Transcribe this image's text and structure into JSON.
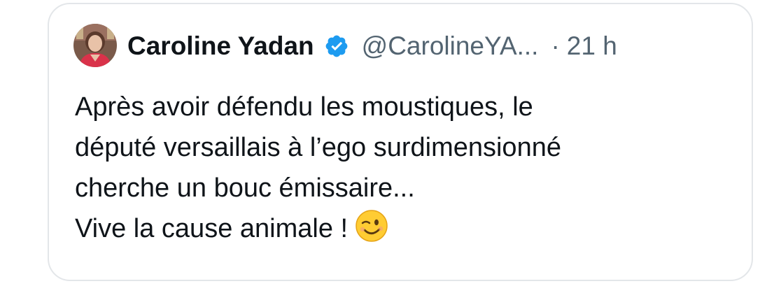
{
  "tweet": {
    "author_name": "Caroline Yadan",
    "handle": "@CarolineYA...",
    "separator": "·",
    "time": "21 h",
    "lines": [
      "Après avoir défendu les moustiques, le",
      "député versaillais à l’ego surdimensionné",
      "cherche un bouc émissaire...",
      "Vive la cause animale !"
    ],
    "emoji": "winking-face",
    "verified_color": "#1d9bf0"
  }
}
